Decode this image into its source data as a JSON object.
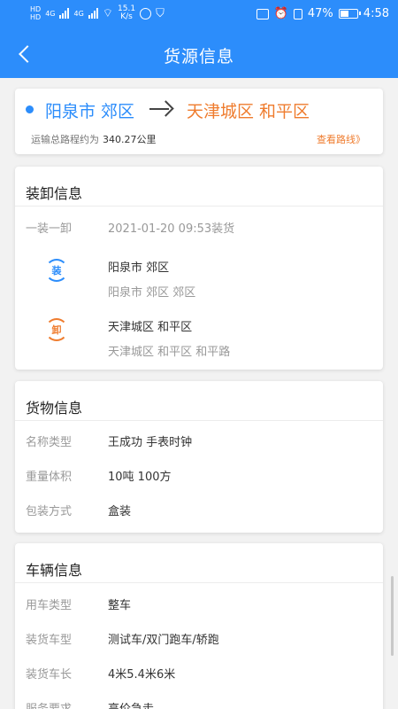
{
  "status_bar": {
    "hd1": "HD",
    "hd2": "HD",
    "net1": "4G",
    "net2": "4G",
    "speed_value": "15.1",
    "speed_unit": "K/s",
    "battery": "47%",
    "time": "4:58"
  },
  "header": {
    "title": "货源信息"
  },
  "route": {
    "from": "阳泉市 郊区",
    "to": "天津城区 和平区",
    "distance_label": "运输总路程约为",
    "distance_value": "340.27公里",
    "view_route": "查看路线》"
  },
  "loading": {
    "title": "装卸信息",
    "type_label": "一装一卸",
    "type_value": "2021-01-20 09:53装货",
    "load_icon_char": "装",
    "load_city": "阳泉市 郊区",
    "load_address": "阳泉市 郊区 郊区",
    "unload_icon_char": "卸",
    "unload_city": "天津城区 和平区",
    "unload_address": "天津城区 和平区 和平路"
  },
  "goods": {
    "title": "货物信息",
    "rows": [
      {
        "label": "名称类型",
        "value": "王成功 手表时钟"
      },
      {
        "label": "重量体积",
        "value": "10吨 100方"
      },
      {
        "label": "包装方式",
        "value": "盒装"
      }
    ]
  },
  "vehicle": {
    "title": "车辆信息",
    "rows": [
      {
        "label": "用车类型",
        "value": "整车"
      },
      {
        "label": "装货车型",
        "value": "测试车/双门跑车/轿跑"
      },
      {
        "label": "装货车长",
        "value": "4米5.4米6米"
      },
      {
        "label": "服务要求",
        "value": "高价急走"
      }
    ]
  },
  "colors": {
    "primary": "#2c8dfb",
    "accent": "#ef7c2e"
  }
}
